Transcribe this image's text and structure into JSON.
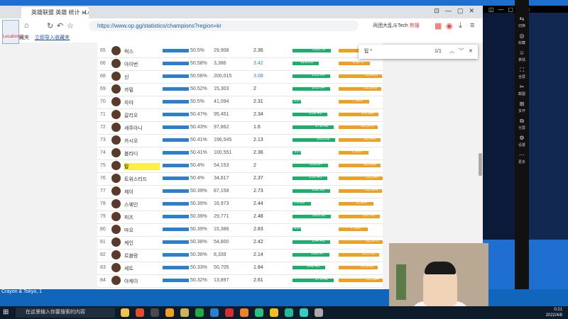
{
  "browser": {
    "tab_title": "英雄联盟 英雄 统计 - League",
    "url": "https://www.op.gg/statistics/champions?region=kr",
    "right_search": "兵团大乱斗Tech",
    "right_search_hot": "热搜",
    "bookmark_text": "导入收藏夹",
    "bookmark_link": "立即导入收藏夹",
    "logo_text": "Lecabond"
  },
  "find": {
    "query": "탑 *",
    "count": "1/1"
  },
  "table": {
    "rows": [
      {
        "rank": "65",
        "name": "럭스",
        "win": "50.5%",
        "win_pct": 50.5,
        "games": "29,908",
        "kda": "2.36",
        "kda_blue": false,
        "gold": "165.78",
        "gold_val": 165.78,
        "other": "11,063",
        "other_val": 11063
      },
      {
        "rank": "66",
        "name": "아이번",
        "win": "50.58%",
        "win_pct": 50.58,
        "games": "3,386",
        "kda": "3.42",
        "kda_blue": true,
        "gold": "113.01",
        "gold_val": 113.01,
        "other": "8,271",
        "other_val": 8271
      },
      {
        "rank": "68",
        "name": "신",
        "win": "50.56%",
        "win_pct": 50.56,
        "games": "200,015",
        "kda": "3.08",
        "kda_blue": true,
        "gold": "165.04",
        "gold_val": 165.04,
        "other": "11,435",
        "other_val": 11435
      },
      {
        "rank": "69",
        "name": "카밀",
        "win": "50.52%",
        "win_pct": 50.52,
        "games": "15,303",
        "kda": "2",
        "kda_blue": false,
        "gold": "165.04",
        "gold_val": 165.04,
        "other": "11,263",
        "other_val": 11263
      },
      {
        "rank": "70",
        "name": "자야",
        "win": "50.5%",
        "win_pct": 50.5,
        "games": "41,094",
        "kda": "2.31",
        "kda_blue": false,
        "gold": "33.73",
        "gold_val": 33.73,
        "other": "7,981",
        "other_val": 7981
      },
      {
        "rank": "71",
        "name": "갈리오",
        "win": "50.47%",
        "win_pct": 50.47,
        "games": "95,451",
        "kda": "2.34",
        "kda_blue": false,
        "gold": "151.41",
        "gold_val": 151.41,
        "other": "10,380",
        "other_val": 10380
      },
      {
        "rank": "72",
        "name": "세주아니",
        "win": "50.43%",
        "win_pct": 50.43,
        "games": "97,862",
        "kda": "1.6",
        "kda_blue": false,
        "gold": "178.48",
        "gold_val": 178.48,
        "other": "10,370",
        "other_val": 10370
      },
      {
        "rank": "73",
        "name": "카시오",
        "win": "50.41%",
        "win_pct": 50.41,
        "games": "196,545",
        "kda": "2.13",
        "kda_blue": false,
        "gold": "185.31",
        "gold_val": 185.31,
        "other": "11,060",
        "other_val": 11060
      },
      {
        "rank": "74",
        "name": "블라디",
        "win": "50.41%",
        "win_pct": 50.41,
        "games": "100,551",
        "kda": "2.36",
        "kda_blue": false,
        "gold": "33.85",
        "gold_val": 33.85,
        "other": "7,867",
        "other_val": 7867
      },
      {
        "rank": "75",
        "name": "탑",
        "win": "50.4%",
        "win_pct": 50.4,
        "games": "54,153",
        "kda": "2",
        "kda_blue": false,
        "gold": "153.97",
        "gold_val": 153.97,
        "other": "11,063",
        "other_val": 11063,
        "highlight": true
      },
      {
        "rank": "76",
        "name": "트위스티드",
        "win": "50.4%",
        "win_pct": 50.4,
        "games": "34,817",
        "kda": "2.37",
        "kda_blue": false,
        "gold": "151.45",
        "gold_val": 151.45,
        "other": "11,590",
        "other_val": 11590
      },
      {
        "rank": "77",
        "name": "제이",
        "win": "50.39%",
        "win_pct": 50.39,
        "games": "87,158",
        "kda": "2.73",
        "kda_blue": false,
        "gold": "162.69",
        "gold_val": 162.69,
        "other": "11,394",
        "other_val": 11394
      },
      {
        "rank": "78",
        "name": "스웨인",
        "win": "50.39%",
        "win_pct": 50.39,
        "games": "16,973",
        "kda": "2.44",
        "kda_blue": false,
        "gold": "79.89",
        "gold_val": 79.89,
        "other": "9,114",
        "other_val": 9114
      },
      {
        "rank": "79",
        "name": "피즈",
        "win": "50.39%",
        "win_pct": 50.39,
        "games": "29,771",
        "kda": "2.48",
        "kda_blue": false,
        "gold": "165.36",
        "gold_val": 165.36,
        "other": "10,767",
        "other_val": 10767
      },
      {
        "rank": "80",
        "name": "마오",
        "win": "50.39%",
        "win_pct": 50.39,
        "games": "15,386",
        "kda": "2.83",
        "kda_blue": false,
        "gold": "25.38",
        "gold_val": 25.38,
        "other": "7,587",
        "other_val": 7587
      },
      {
        "rank": "81",
        "name": "케인",
        "win": "50.38%",
        "win_pct": 50.38,
        "games": "54,800",
        "kda": "2.42",
        "kda_blue": false,
        "gold": "164.43",
        "gold_val": 164.43,
        "other": "11,570",
        "other_val": 11570
      },
      {
        "rank": "82",
        "name": "르블랑",
        "win": "50.36%",
        "win_pct": 50.36,
        "games": "8,339",
        "kda": "2.14",
        "kda_blue": false,
        "gold": "160.47",
        "gold_val": 160.47,
        "other": "10,713",
        "other_val": 10713
      },
      {
        "rank": "83",
        "name": "세트",
        "win": "50.33%",
        "win_pct": 50.33,
        "games": "50,705",
        "kda": "1.84",
        "kda_blue": false,
        "gold": "142.41",
        "gold_val": 142.41,
        "other": "10,291",
        "other_val": 10291
      },
      {
        "rank": "84",
        "name": "아케이",
        "win": "50.32%",
        "win_pct": 50.32,
        "games": "13,897",
        "kda": "2.61",
        "kda_blue": false,
        "gold": "179.42",
        "gold_val": 179.42,
        "other": "11,594",
        "other_val": 11594
      }
    ]
  },
  "right_panel": {
    "items": [
      {
        "icon": "⇆",
        "label": "切换"
      },
      {
        "icon": "◎",
        "label": "收藏"
      },
      {
        "icon": "☺",
        "label": "表情"
      },
      {
        "icon": "⛶",
        "label": "全屏"
      },
      {
        "icon": "✂",
        "label": "截图"
      },
      {
        "icon": "⊞",
        "label": "多开"
      },
      {
        "icon": "⧉",
        "label": "分屏"
      },
      {
        "icon": "⚙",
        "label": "设置"
      },
      {
        "icon": "⋯",
        "label": "更多"
      }
    ]
  },
  "desktop": {
    "label": "Crayon & Tokyo, 1"
  },
  "taskbar": {
    "search_placeholder": "在这里输入你要搜索的内容",
    "time": "0:21",
    "date": "2022/4/8",
    "icons": [
      "#f3c24b",
      "#e44b2a",
      "#4a4a4a",
      "#f0a020",
      "#c9b45a",
      "#22aa44",
      "#2a7fd0",
      "#d03030",
      "#f08030",
      "#2ac080",
      "#f0c020",
      "#22bb99",
      "#30d0c0",
      "#aaaaaa"
    ]
  },
  "colors": {
    "winbar": "#2a7fd0",
    "goldbar": "#1bb06a",
    "orangebar": "#f0a020",
    "highlight": "#ffee44"
  }
}
